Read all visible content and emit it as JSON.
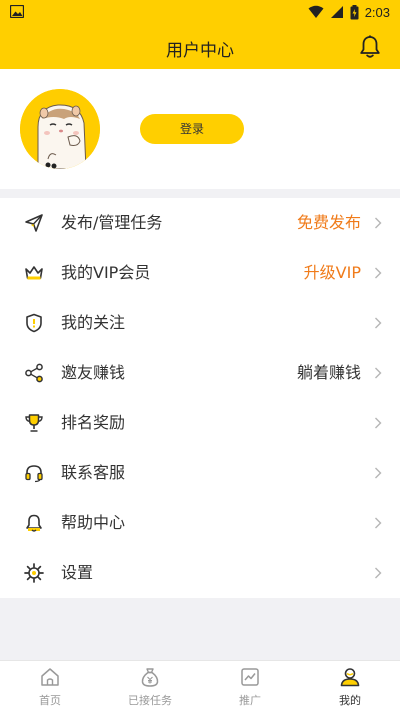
{
  "status_bar": {
    "time": "2:03"
  },
  "header": {
    "title": "用户中心"
  },
  "profile": {
    "login_label": "登录"
  },
  "menu": [
    {
      "name": "publish",
      "label": "发布/管理任务",
      "value": "免费发布",
      "value_style": "orange",
      "icon": "paper-plane-icon"
    },
    {
      "name": "vip",
      "label": "我的VIP会员",
      "value": "升级VIP",
      "value_style": "orange",
      "icon": "crown-icon"
    },
    {
      "name": "follow",
      "label": "我的关注",
      "value": "",
      "value_style": "",
      "icon": "shield-icon"
    },
    {
      "name": "invite",
      "label": "邀友赚钱",
      "value": "躺着赚钱",
      "value_style": "dark",
      "icon": "share-icon"
    },
    {
      "name": "ranking",
      "label": "排名奖励",
      "value": "",
      "value_style": "",
      "icon": "trophy-icon"
    },
    {
      "name": "support",
      "label": "联系客服",
      "value": "",
      "value_style": "",
      "icon": "headset-icon"
    },
    {
      "name": "help",
      "label": "帮助中心",
      "value": "",
      "value_style": "",
      "icon": "help-bell-icon"
    },
    {
      "name": "settings",
      "label": "设置",
      "value": "",
      "value_style": "",
      "icon": "gear-icon"
    }
  ],
  "tabs": [
    {
      "label": "首页",
      "icon": "home-icon",
      "active": false
    },
    {
      "label": "已接任务",
      "icon": "money-bag-icon",
      "active": false
    },
    {
      "label": "推广",
      "icon": "chart-icon",
      "active": false
    },
    {
      "label": "我的",
      "icon": "user-icon",
      "active": true
    }
  ],
  "colors": {
    "accent": "#ffcf00",
    "orange_text": "#f07b1a",
    "background": "#f1f1f4"
  }
}
